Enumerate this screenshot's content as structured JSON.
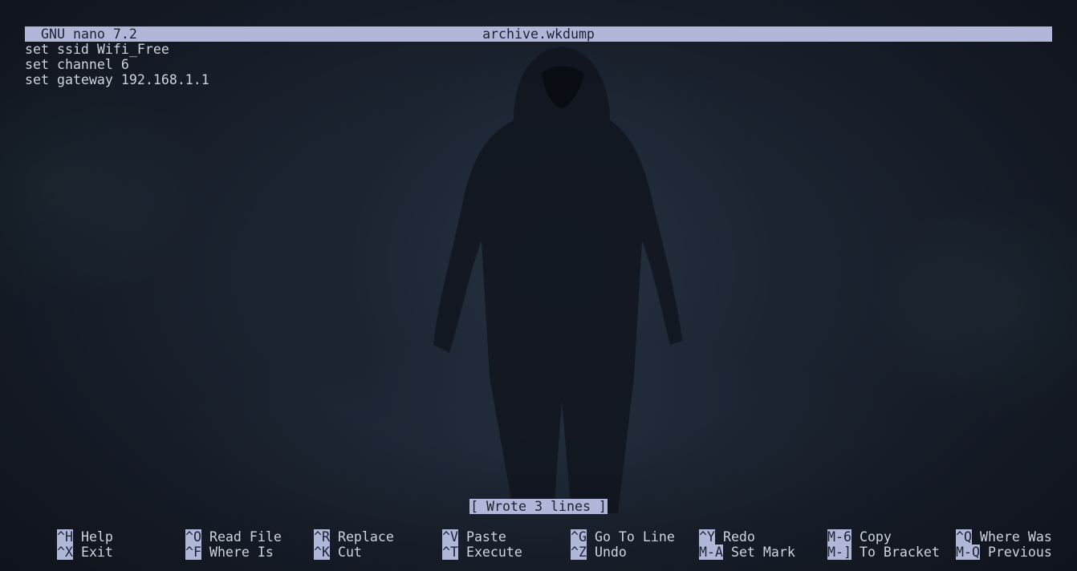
{
  "title_bar": {
    "app": "GNU nano 7.2",
    "filename": "archive.wkdump"
  },
  "buffer": {
    "lines": [
      "set ssid Wifi_Free",
      "set channel 6",
      "set gateway 192.168.1.1"
    ]
  },
  "status": "[ Wrote 3 lines ]",
  "shortcuts": {
    "row1": [
      {
        "key": "^H",
        "label": "Help"
      },
      {
        "key": "^O",
        "label": "Read File"
      },
      {
        "key": "^R",
        "label": "Replace"
      },
      {
        "key": "^V",
        "label": "Paste"
      },
      {
        "key": "^G",
        "label": "Go To Line"
      },
      {
        "key": "^Y",
        "label": "Redo"
      },
      {
        "key": "M-6",
        "label": "Copy"
      },
      {
        "key": "^Q",
        "label": "Where Was"
      }
    ],
    "row2": [
      {
        "key": "^X",
        "label": "Exit"
      },
      {
        "key": "^F",
        "label": "Where Is"
      },
      {
        "key": "^K",
        "label": "Cut"
      },
      {
        "key": "^T",
        "label": "Execute"
      },
      {
        "key": "^Z",
        "label": "Undo"
      },
      {
        "key": "M-A",
        "label": "Set Mark"
      },
      {
        "key": "M-]",
        "label": "To Bracket"
      },
      {
        "key": "M-Q",
        "label": "Previous"
      }
    ]
  },
  "colors": {
    "background": "#1b2330",
    "highlight": "#b1b7d9",
    "text": "#cdd3df"
  }
}
